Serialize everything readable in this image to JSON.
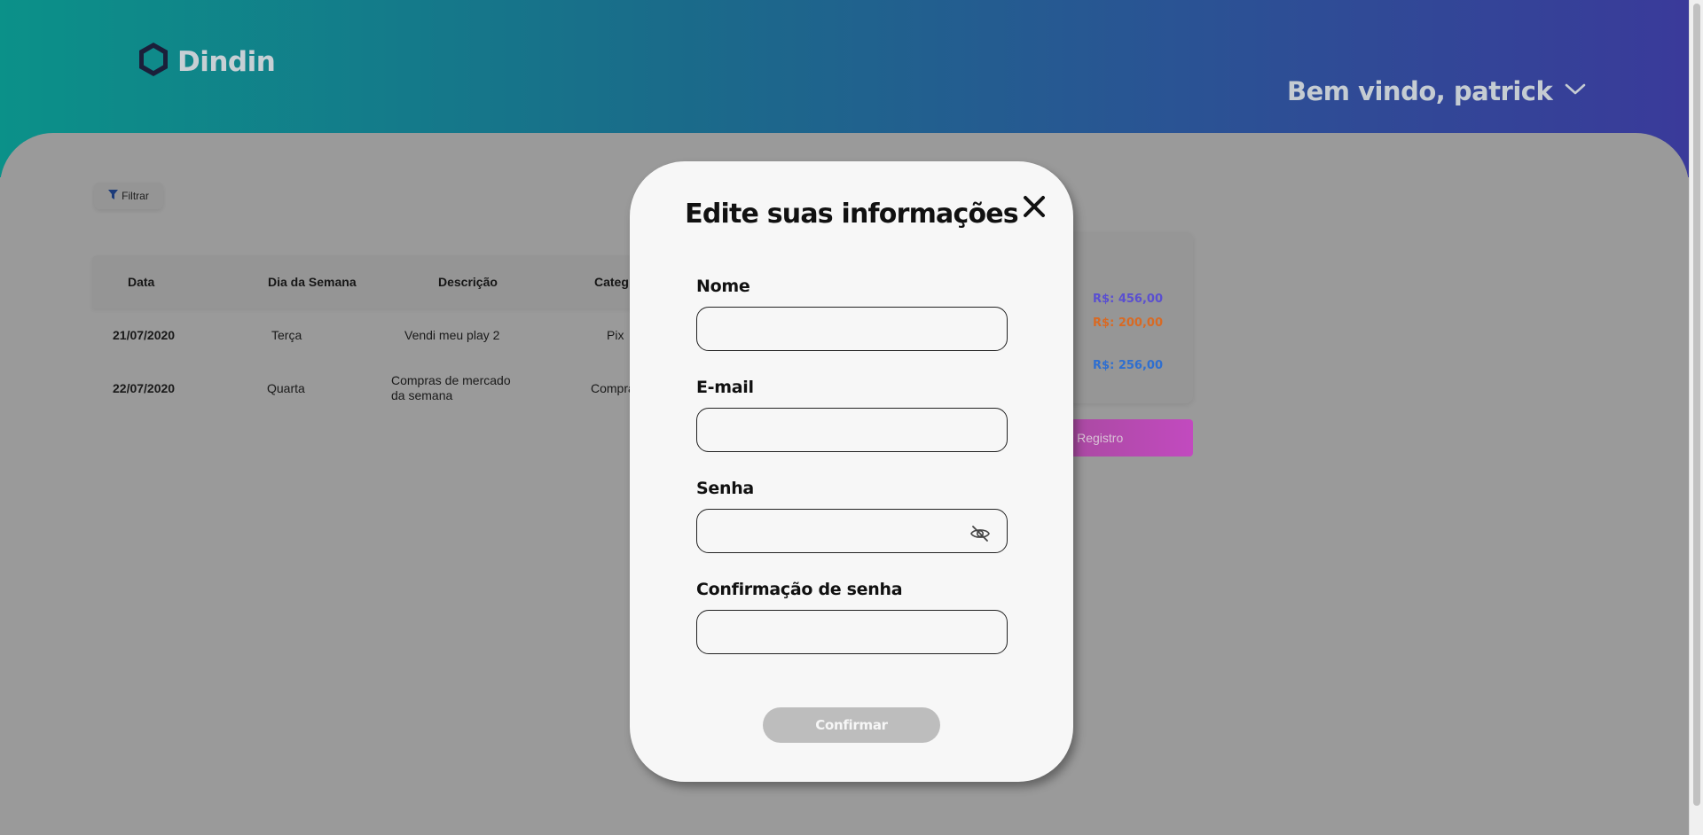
{
  "brand": {
    "name": "Dindin",
    "logo_icon": "hexagon-logo-icon"
  },
  "header": {
    "welcome": "Bem vindo, patrick",
    "dropdown_icon": "chevron-down-icon"
  },
  "toolbar": {
    "filter_label": "Filtrar",
    "filter_icon": "funnel-icon"
  },
  "table": {
    "columns": [
      "Data",
      "Dia da Semana",
      "Descrição",
      "Categ"
    ],
    "rows": [
      {
        "date": "21/07/2020",
        "weekday": "Terça",
        "description": "Vendi meu play 2",
        "description_line2": "",
        "category": "Pix"
      },
      {
        "date": "22/07/2020",
        "weekday": "Quarta",
        "description": "Compras de mercado",
        "description_line2": "da semana",
        "category": "Compra"
      }
    ]
  },
  "summary": {
    "values": [
      "R$: 456,00",
      "R$: 200,00",
      "R$: 256,00"
    ],
    "colors": {
      "entrada": "#5a4fd1",
      "saida": "#d86a24",
      "saldo": "#2f6fd0"
    }
  },
  "add_record": {
    "label": "nar Registro"
  },
  "modal": {
    "title": "Edite suas informações",
    "close_icon": "close-icon",
    "fields": {
      "name": {
        "label": "Nome",
        "value": ""
      },
      "email": {
        "label": "E-mail",
        "value": ""
      },
      "password": {
        "label": "Senha",
        "value": "",
        "toggle_icon": "eye-slash-icon"
      },
      "password_confirm": {
        "label": "Confirmação de senha",
        "value": ""
      }
    },
    "confirm_label": "Confirmar"
  },
  "colors": {
    "header_gradient_start": "#0b9189",
    "header_gradient_end": "#3a3a9a",
    "overlay": "#9a9a9a",
    "modal_bg": "#f7f7f7",
    "confirm_disabled": "#bdbdbd"
  }
}
